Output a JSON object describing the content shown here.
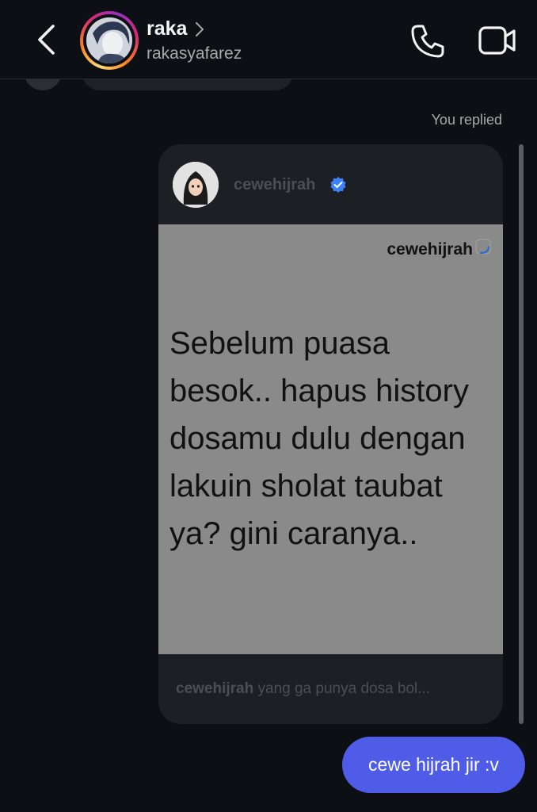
{
  "header": {
    "name": "raka",
    "username": "rakasyafarez",
    "icons": {
      "back": "chevron-left-icon",
      "name_chevron": "chevron-right-icon",
      "call": "phone-icon",
      "video": "video-camera-icon"
    }
  },
  "thread": {
    "reply_label": "You replied",
    "shared_post": {
      "username": "cewehijrah",
      "verified": true,
      "image": {
        "handle": "cewehijrah",
        "text": "Sebelum puasa besok.. hapus history dosamu dulu dengan lakuin sholat taubat ya? gini caranya.."
      },
      "caption_user": "cewehijrah",
      "caption_text": "yang ga punya dosa bol..."
    },
    "sent_message": "cewe hijrah jir :v"
  },
  "colors": {
    "background": "#0c1014",
    "sent_bubble": "#4f5ce8",
    "verified_badge": "#3b82f6",
    "post_card": "#1c1f23"
  }
}
